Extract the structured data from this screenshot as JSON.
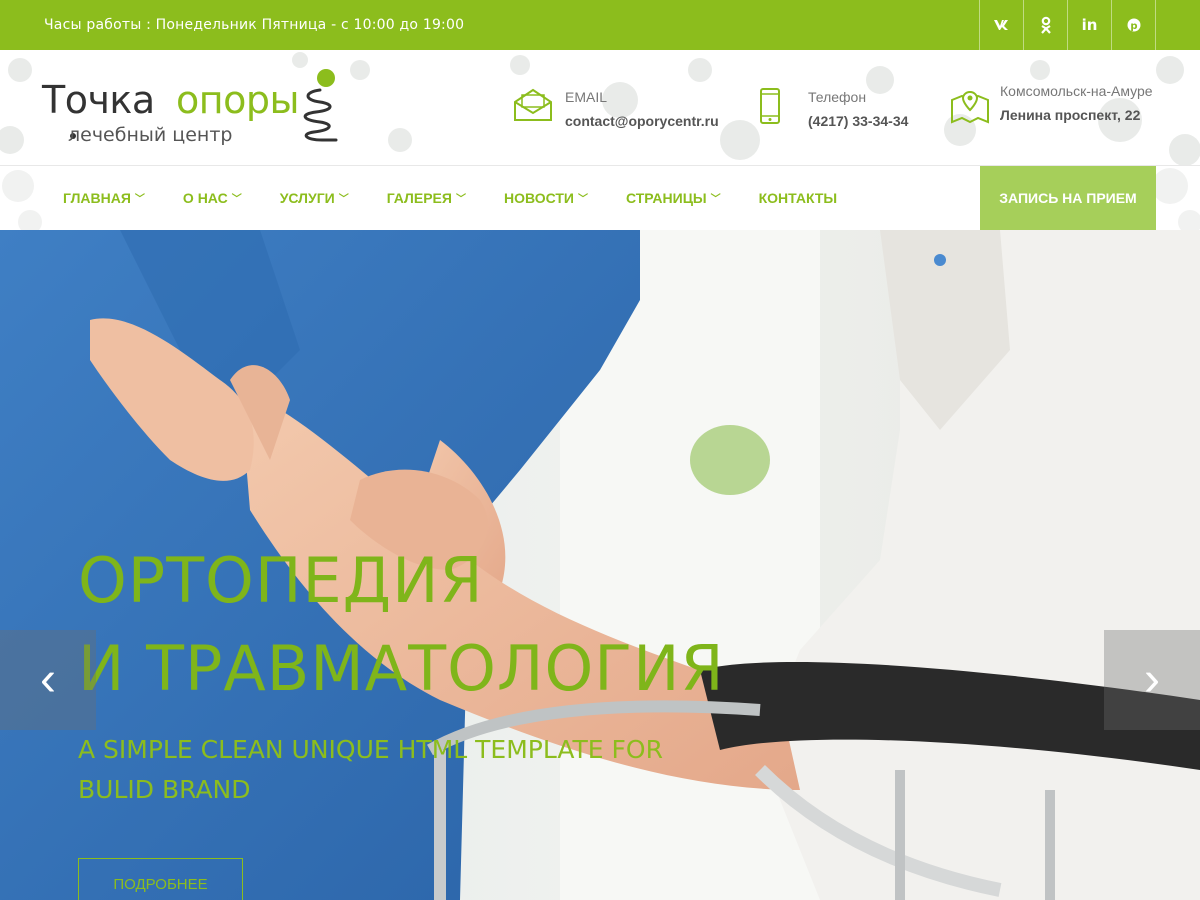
{
  "topbar": {
    "hours": "Часы работы : Понедельник Пятница - с 10:00 до 19:00",
    "social": [
      {
        "name": "vk-icon",
        "glyph": "vk"
      },
      {
        "name": "odnoklassniki-icon",
        "glyph": "ok"
      },
      {
        "name": "linkedin-icon",
        "glyph": "in"
      },
      {
        "name": "pinterest-icon",
        "glyph": "℗"
      }
    ]
  },
  "logo": {
    "word1": "Точка",
    "word2": "опоры",
    "tagline": "лечебный центр"
  },
  "contacts": {
    "email": {
      "label": "EMAIL",
      "value": "contact@oporycentr.ru"
    },
    "phone": {
      "label": "Телефон",
      "value": "(4217) 33-34-34"
    },
    "address": {
      "label": "Комсомольск-на-Амуре",
      "value": "Ленина проспект, 22"
    }
  },
  "nav": {
    "items": [
      {
        "label": "ГЛАВНАЯ",
        "dropdown": true
      },
      {
        "label": "О НАС",
        "dropdown": true
      },
      {
        "label": "УСЛУГИ",
        "dropdown": true
      },
      {
        "label": "ГАЛЕРЕЯ",
        "dropdown": true
      },
      {
        "label": "НОВОСТИ",
        "dropdown": true
      },
      {
        "label": "СТРАНИЦЫ",
        "dropdown": true
      },
      {
        "label": "КОНТАКТЫ",
        "dropdown": false
      }
    ],
    "cta": "ЗАПИСЬ НА ПРИЕМ"
  },
  "hero": {
    "title_line1": "ОРТОПЕДИЯ",
    "title_line2": "И ТРАВМАТОЛОГИЯ",
    "subtitle": "A SIMPLE CLEAN UNIQUE HTML TEMPLATE FOR BULID BRAND",
    "button": "ПОДРОБНЕЕ",
    "prev_glyph": "‹",
    "next_glyph": "›"
  },
  "colors": {
    "accent": "#8cbd1d",
    "cta": "#a6cf5a",
    "text": "#555555"
  }
}
